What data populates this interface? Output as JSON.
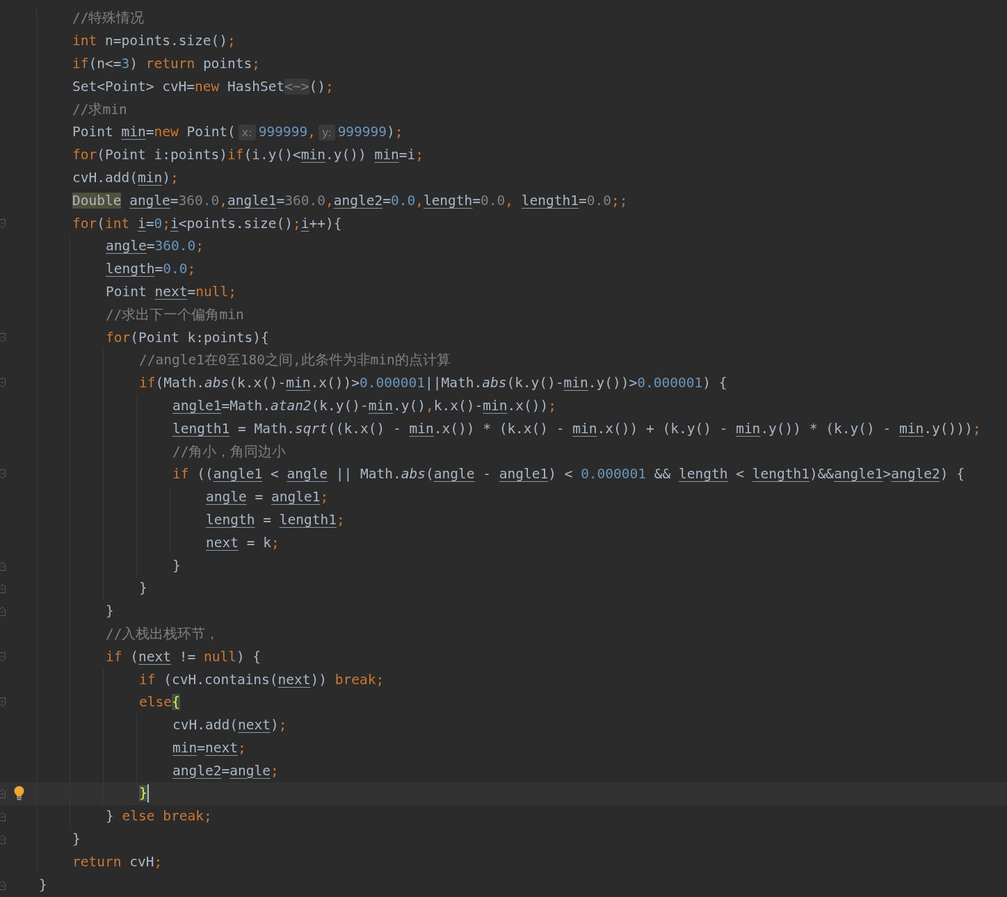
{
  "lines": [
    {
      "children": [
        {
          "segments": [
            {
              "text": "//特殊情况",
              "kind": "cmt"
            }
          ]
        },
        {
          "segments": [
            {
              "text": "int",
              "kind": "kw"
            },
            {
              "text": " n=points.size()",
              "kind": "plain"
            },
            {
              "text": ";",
              "kind": "punct"
            }
          ]
        },
        {
          "segments": [
            {
              "text": "if",
              "kind": "kw"
            },
            {
              "text": "(n<=",
              "kind": "plain"
            },
            {
              "text": "3",
              "kind": "num"
            },
            {
              "text": ") ",
              "kind": "plain"
            },
            {
              "text": "return",
              "kind": "kw"
            },
            {
              "text": " points",
              "kind": "plain"
            },
            {
              "text": ";",
              "kind": "punct"
            }
          ]
        },
        {
          "segments": [
            {
              "text": "Set<Point> cvH=",
              "kind": "plain"
            },
            {
              "text": "new",
              "kind": "kw"
            },
            {
              "text": " HashSet",
              "kind": "plain"
            },
            {
              "text": "<~>",
              "kind": "fold"
            },
            {
              "text": "()",
              "kind": "plain"
            },
            {
              "text": ";",
              "kind": "punct"
            }
          ]
        },
        {
          "segments": [
            {
              "text": "//求min",
              "kind": "cmt"
            }
          ]
        },
        {
          "segments": [
            {
              "text": "Point ",
              "kind": "plain"
            },
            {
              "text": "min",
              "kind": "var"
            },
            {
              "text": "=",
              "kind": "plain"
            },
            {
              "text": "new",
              "kind": "kw"
            },
            {
              "text": " Point(",
              "kind": "plain"
            },
            {
              "text": "x:",
              "kind": "hint"
            },
            {
              "text": "999999",
              "kind": "num"
            },
            {
              "text": ",",
              "kind": "punct"
            },
            {
              "text": "y:",
              "kind": "hint"
            },
            {
              "text": "999999",
              "kind": "num"
            },
            {
              "text": ")",
              "kind": "plain"
            },
            {
              "text": ";",
              "kind": "punct"
            }
          ]
        },
        {
          "segments": [
            {
              "text": "for",
              "kind": "kw"
            },
            {
              "text": "(Point i:points)",
              "kind": "plain"
            },
            {
              "text": "if",
              "kind": "kw"
            },
            {
              "text": "(i.y()<",
              "kind": "plain"
            },
            {
              "text": "min",
              "kind": "var"
            },
            {
              "text": ".y()) ",
              "kind": "plain"
            },
            {
              "text": "min",
              "kind": "var"
            },
            {
              "text": "=i",
              "kind": "plain"
            },
            {
              "text": ";",
              "kind": "punct"
            }
          ]
        },
        {
          "segments": [
            {
              "text": "cvH.add(",
              "kind": "plain"
            },
            {
              "text": "min",
              "kind": "var"
            },
            {
              "text": ")",
              "kind": "plain"
            },
            {
              "text": ";",
              "kind": "punct"
            }
          ]
        },
        {
          "segments": [
            {
              "text": "Double",
              "kind": "mark"
            },
            {
              "text": "angle",
              "kind": "var"
            },
            {
              "text": "=",
              "kind": "plain"
            },
            {
              "text": "360.0",
              "kind": "dim"
            },
            {
              "text": ",",
              "kind": "punct"
            },
            {
              "text": "angle1",
              "kind": "var"
            },
            {
              "text": "=",
              "kind": "plain"
            },
            {
              "text": "360.0",
              "kind": "dim"
            },
            {
              "text": ",",
              "kind": "punct"
            },
            {
              "text": "angle2",
              "kind": "var"
            },
            {
              "text": "=",
              "kind": "plain"
            },
            {
              "text": "0.0",
              "kind": "num"
            },
            {
              "text": ",",
              "kind": "punct"
            },
            {
              "text": "length",
              "kind": "var"
            },
            {
              "text": "=",
              "kind": "plain"
            },
            {
              "text": "0.0",
              "kind": "dim"
            },
            {
              "text": ", ",
              "kind": "punct"
            },
            {
              "text": "length1",
              "kind": "var"
            },
            {
              "text": "=",
              "kind": "plain"
            },
            {
              "text": "0.0",
              "kind": "dim"
            },
            {
              "text": ";",
              "kind": "punct"
            },
            {
              "text": ";",
              "kind": "dim"
            }
          ]
        },
        {
          "fold_start": true,
          "segments": [
            {
              "text": "for",
              "kind": "kw"
            },
            {
              "text": "(",
              "kind": "plain"
            },
            {
              "text": "int ",
              "kind": "kw"
            },
            {
              "text": "i",
              "kind": "var"
            },
            {
              "text": "=",
              "kind": "plain"
            },
            {
              "text": "0",
              "kind": "num"
            },
            {
              "text": ";",
              "kind": "punct"
            },
            {
              "text": "i",
              "kind": "var"
            },
            {
              "text": "<points.size()",
              "kind": "plain"
            },
            {
              "text": ";",
              "kind": "punct"
            },
            {
              "text": "i",
              "kind": "var"
            },
            {
              "text": "++){",
              "kind": "plain"
            }
          ],
          "children": [
            {
              "segments": [
                {
                  "text": "angle",
                  "kind": "var"
                },
                {
                  "text": "=",
                  "kind": "plain"
                },
                {
                  "text": "360.0",
                  "kind": "num"
                },
                {
                  "text": ";",
                  "kind": "punct"
                }
              ]
            },
            {
              "segments": [
                {
                  "text": "length",
                  "kind": "var"
                },
                {
                  "text": "=",
                  "kind": "plain"
                },
                {
                  "text": "0.0",
                  "kind": "num"
                },
                {
                  "text": ";",
                  "kind": "punct"
                }
              ]
            },
            {
              "segments": [
                {
                  "text": "Point ",
                  "kind": "plain"
                },
                {
                  "text": "next",
                  "kind": "var"
                },
                {
                  "text": "=",
                  "kind": "plain"
                },
                {
                  "text": "null",
                  "kind": "kw"
                },
                {
                  "text": ";",
                  "kind": "punct"
                }
              ]
            },
            {
              "segments": [
                {
                  "text": "//求出下一个偏角min",
                  "kind": "cmt"
                }
              ]
            },
            {
              "fold_start": true,
              "segments": [
                {
                  "text": "for",
                  "kind": "kw"
                },
                {
                  "text": "(Point k:points){",
                  "kind": "plain"
                }
              ],
              "children": [
                {
                  "segments": [
                    {
                      "text": "//angle1在0至180之间,此条件为非min的点计算",
                      "kind": "cmt"
                    }
                  ]
                },
                {
                  "fold_start": true,
                  "segments": [
                    {
                      "text": "if",
                      "kind": "kw"
                    },
                    {
                      "text": "(Math.",
                      "kind": "plain"
                    },
                    {
                      "text": "abs",
                      "kind": "fn"
                    },
                    {
                      "text": "(k.x()-",
                      "kind": "plain"
                    },
                    {
                      "text": "min",
                      "kind": "var"
                    },
                    {
                      "text": ".x())>",
                      "kind": "plain"
                    },
                    {
                      "text": "0.000001",
                      "kind": "num"
                    },
                    {
                      "text": "||Math.",
                      "kind": "plain"
                    },
                    {
                      "text": "abs",
                      "kind": "fn"
                    },
                    {
                      "text": "(k.y()-",
                      "kind": "plain"
                    },
                    {
                      "text": "min",
                      "kind": "var"
                    },
                    {
                      "text": ".y())>",
                      "kind": "plain"
                    },
                    {
                      "text": "0.000001",
                      "kind": "num"
                    },
                    {
                      "text": ") {",
                      "kind": "plain"
                    }
                  ],
                  "children": [
                    {
                      "segments": [
                        {
                          "text": "angle1",
                          "kind": "var"
                        },
                        {
                          "text": "=Math.",
                          "kind": "plain"
                        },
                        {
                          "text": "atan2",
                          "kind": "fn"
                        },
                        {
                          "text": "(k.y()-",
                          "kind": "plain"
                        },
                        {
                          "text": "min",
                          "kind": "var"
                        },
                        {
                          "text": ".y()",
                          "kind": "plain"
                        },
                        {
                          "text": ",",
                          "kind": "punct"
                        },
                        {
                          "text": "k.x()-",
                          "kind": "plain"
                        },
                        {
                          "text": "min",
                          "kind": "var"
                        },
                        {
                          "text": ".x())",
                          "kind": "plain"
                        },
                        {
                          "text": ";",
                          "kind": "punct"
                        }
                      ]
                    },
                    {
                      "segments": [
                        {
                          "text": "length1",
                          "kind": "var"
                        },
                        {
                          "text": " = Math.",
                          "kind": "plain"
                        },
                        {
                          "text": "sqrt",
                          "kind": "fn"
                        },
                        {
                          "text": "((k.x() - ",
                          "kind": "plain"
                        },
                        {
                          "text": "min",
                          "kind": "var"
                        },
                        {
                          "text": ".x()) * (k.x() - ",
                          "kind": "plain"
                        },
                        {
                          "text": "min",
                          "kind": "var"
                        },
                        {
                          "text": ".x()) + (k.y() - ",
                          "kind": "plain"
                        },
                        {
                          "text": "min",
                          "kind": "var"
                        },
                        {
                          "text": ".y()) * (k.y() - ",
                          "kind": "plain"
                        },
                        {
                          "text": "min",
                          "kind": "var"
                        },
                        {
                          "text": ".y()))",
                          "kind": "plain"
                        },
                        {
                          "text": ";",
                          "kind": "punct"
                        }
                      ]
                    },
                    {
                      "segments": [
                        {
                          "text": "//角小，角同边小",
                          "kind": "cmt"
                        }
                      ]
                    },
                    {
                      "fold_start": true,
                      "segments": [
                        {
                          "text": "if",
                          "kind": "kw"
                        },
                        {
                          "text": " ((",
                          "kind": "plain"
                        },
                        {
                          "text": "angle1",
                          "kind": "var"
                        },
                        {
                          "text": " < ",
                          "kind": "plain"
                        },
                        {
                          "text": "angle",
                          "kind": "var"
                        },
                        {
                          "text": " || Math.",
                          "kind": "plain"
                        },
                        {
                          "text": "abs",
                          "kind": "fn"
                        },
                        {
                          "text": "(",
                          "kind": "plain"
                        },
                        {
                          "text": "angle",
                          "kind": "var"
                        },
                        {
                          "text": " - ",
                          "kind": "plain"
                        },
                        {
                          "text": "angle1",
                          "kind": "var"
                        },
                        {
                          "text": ") < ",
                          "kind": "plain"
                        },
                        {
                          "text": "0.000001",
                          "kind": "num"
                        },
                        {
                          "text": " && ",
                          "kind": "plain"
                        },
                        {
                          "text": "length",
                          "kind": "var"
                        },
                        {
                          "text": " < ",
                          "kind": "plain"
                        },
                        {
                          "text": "length1",
                          "kind": "var"
                        },
                        {
                          "text": ")&&",
                          "kind": "plain"
                        },
                        {
                          "text": "angle1",
                          "kind": "var"
                        },
                        {
                          "text": ">",
                          "kind": "plain"
                        },
                        {
                          "text": "angle2",
                          "kind": "var"
                        },
                        {
                          "text": ") {",
                          "kind": "plain"
                        }
                      ],
                      "children": [
                        {
                          "segments": [
                            {
                              "text": "angle",
                              "kind": "var"
                            },
                            {
                              "text": " = ",
                              "kind": "plain"
                            },
                            {
                              "text": "angle1",
                              "kind": "var"
                            },
                            {
                              "text": ";",
                              "kind": "punct"
                            }
                          ]
                        },
                        {
                          "segments": [
                            {
                              "text": "length",
                              "kind": "var"
                            },
                            {
                              "text": " = ",
                              "kind": "plain"
                            },
                            {
                              "text": "length1",
                              "kind": "var"
                            },
                            {
                              "text": ";",
                              "kind": "punct"
                            }
                          ]
                        },
                        {
                          "segments": [
                            {
                              "text": "next",
                              "kind": "var"
                            },
                            {
                              "text": " = k",
                              "kind": "plain"
                            },
                            {
                              "text": ";",
                              "kind": "punct"
                            }
                          ]
                        }
                      ]
                    },
                    {
                      "fold_end": true,
                      "segments": [
                        {
                          "text": "}",
                          "kind": "plain"
                        }
                      ]
                    }
                  ]
                },
                {
                  "fold_end": true,
                  "segments": [
                    {
                      "text": "}",
                      "kind": "plain"
                    }
                  ]
                }
              ]
            },
            {
              "fold_end": true,
              "segments": [
                {
                  "text": "}",
                  "kind": "plain"
                }
              ]
            },
            {
              "segments": [
                {
                  "text": "//入栈出栈环节，",
                  "kind": "cmt"
                }
              ]
            },
            {
              "fold_start": true,
              "segments": [
                {
                  "text": "if",
                  "kind": "kw"
                },
                {
                  "text": " (",
                  "kind": "plain"
                },
                {
                  "text": "next",
                  "kind": "var"
                },
                {
                  "text": " != ",
                  "kind": "plain"
                },
                {
                  "text": "null",
                  "kind": "kw"
                },
                {
                  "text": ") {",
                  "kind": "plain"
                }
              ],
              "children": [
                {
                  "segments": [
                    {
                      "text": "if",
                      "kind": "kw"
                    },
                    {
                      "text": " (cvH.contains(",
                      "kind": "plain"
                    },
                    {
                      "text": "next",
                      "kind": "var"
                    },
                    {
                      "text": ")) ",
                      "kind": "plain"
                    },
                    {
                      "text": "break",
                      "kind": "kw"
                    },
                    {
                      "text": ";",
                      "kind": "punct"
                    }
                  ]
                },
                {
                  "fold_start": true,
                  "segments": [
                    {
                      "text": "else",
                      "kind": "kw"
                    },
                    {
                      "text": "{",
                      "kind": "match"
                    }
                  ],
                  "children": [
                    {
                      "segments": [
                        {
                          "text": "cvH.add(",
                          "kind": "plain"
                        },
                        {
                          "text": "next",
                          "kind": "var"
                        },
                        {
                          "text": ")",
                          "kind": "plain"
                        },
                        {
                          "text": ";",
                          "kind": "punct"
                        }
                      ]
                    },
                    {
                      "segments": [
                        {
                          "text": "min",
                          "kind": "var"
                        },
                        {
                          "text": "=",
                          "kind": "plain"
                        },
                        {
                          "text": "next",
                          "kind": "var"
                        },
                        {
                          "text": ";",
                          "kind": "punct"
                        }
                      ]
                    },
                    {
                      "segments": [
                        {
                          "text": "angle2",
                          "kind": "var"
                        },
                        {
                          "text": "=",
                          "kind": "plain"
                        },
                        {
                          "text": "angle",
                          "kind": "var"
                        },
                        {
                          "text": ";",
                          "kind": "punct"
                        }
                      ]
                    }
                  ]
                },
                {
                  "fold_end": true,
                  "current": true,
                  "bulb": true,
                  "segments": [
                    {
                      "text": "}",
                      "kind": "match"
                    }
                  ]
                }
              ]
            },
            {
              "fold_end": true,
              "segments": [
                {
                  "text": "} ",
                  "kind": "plain"
                },
                {
                  "text": "else break",
                  "kind": "kw"
                },
                {
                  "text": ";",
                  "kind": "punct"
                }
              ]
            }
          ]
        },
        {
          "fold_end": true,
          "segments": [
            {
              "text": "}",
              "kind": "plain"
            }
          ]
        },
        {
          "segments": [
            {
              "text": "return",
              "kind": "kw"
            },
            {
              "text": " cvH",
              "kind": "plain"
            },
            {
              "text": ";",
              "kind": "punct"
            }
          ]
        }
      ]
    },
    {
      "fold_end": true,
      "segments": [
        {
          "text": "}",
          "kind": "plain"
        }
      ]
    }
  ]
}
